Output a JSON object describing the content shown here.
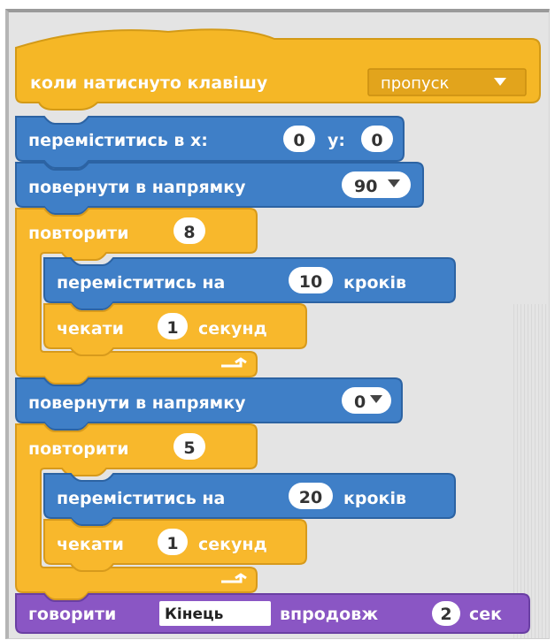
{
  "colors": {
    "events": "#f5b726",
    "events_dark": "#d39a17",
    "motion": "#3f7fc7",
    "motion_dark": "#2c63a3",
    "control": "#f8b82c",
    "control_dark": "#d79a1c",
    "looks": "#8a56c4",
    "looks_dark": "#6a3fa3",
    "slot_bg": "#ffffff"
  },
  "script": {
    "hat": {
      "label": "коли натиснуто клавішу",
      "key": "пропуск",
      "icon": "dropdown-arrow-icon"
    },
    "goto": {
      "label_x": "переміститись в x:",
      "x": "0",
      "label_y": "y:",
      "y": "0"
    },
    "direction1": {
      "label": "повернути в напрямку",
      "value": "90"
    },
    "repeat1": {
      "label": "повторити",
      "count": "8"
    },
    "move1": {
      "label": "переміститись на",
      "steps": "10",
      "unit": "кроків"
    },
    "wait1": {
      "label": "чекати",
      "seconds": "1",
      "unit": "секунд"
    },
    "direction2": {
      "label": "повернути в напрямку",
      "value": "0"
    },
    "repeat2": {
      "label": "повторити",
      "count": "5"
    },
    "move2": {
      "label": "переміститись на",
      "steps": "20",
      "unit": "кроків"
    },
    "wait2": {
      "label": "чекати",
      "seconds": "1",
      "unit": "секунд"
    },
    "say": {
      "label": "говорити",
      "text": "Кінець",
      "label2": "впродовж",
      "seconds": "2",
      "unit": "сек"
    }
  }
}
